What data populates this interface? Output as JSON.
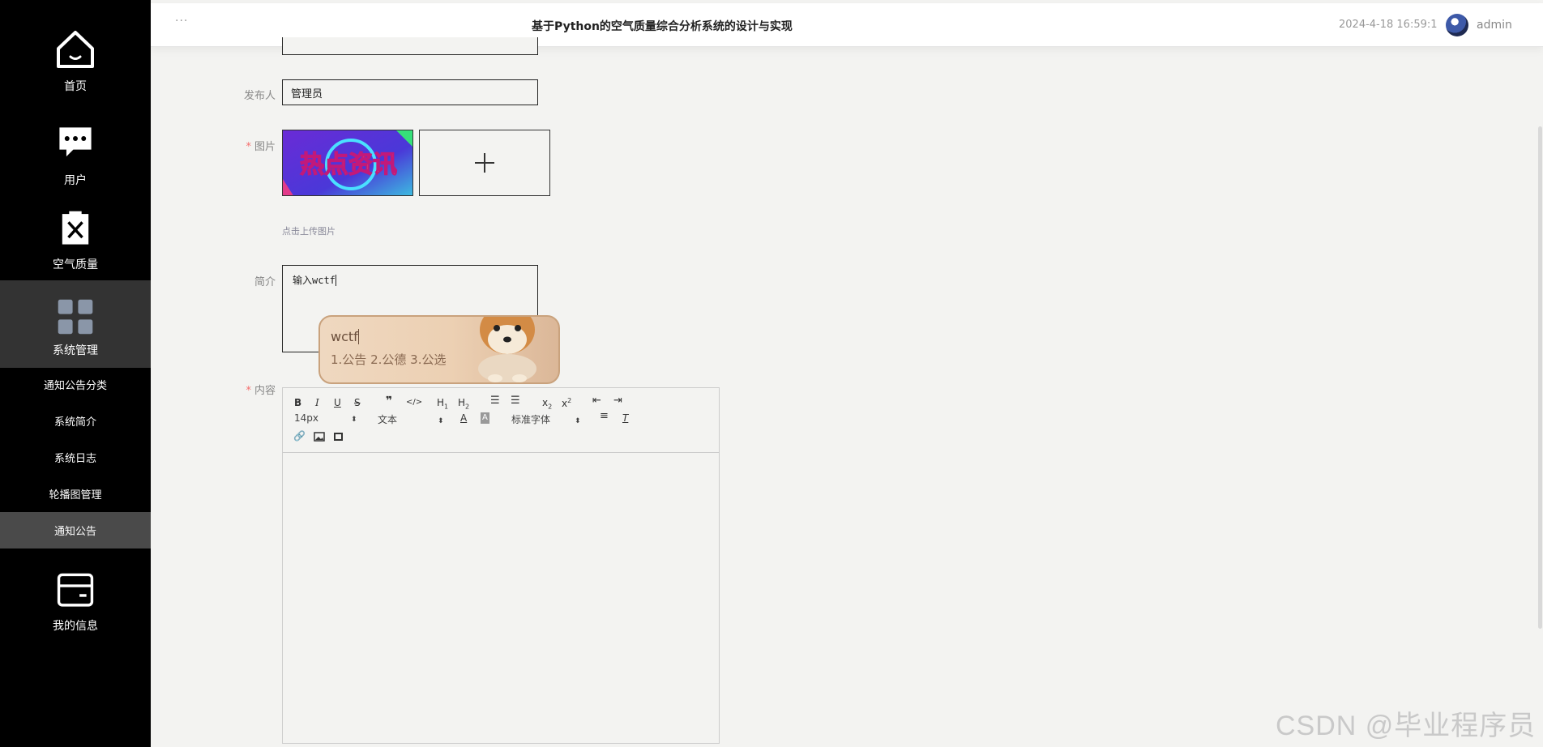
{
  "sidebar": {
    "items": [
      {
        "label": "首页",
        "icon": "home-icon"
      },
      {
        "label": "用户",
        "icon": "chat-icon"
      },
      {
        "label": "空气质量",
        "icon": "clipboard-x-icon"
      },
      {
        "label": "系统管理",
        "icon": "grid-icon"
      },
      {
        "label": "我的信息",
        "icon": "card-icon"
      }
    ],
    "sub_items": [
      "通知公告分类",
      "系统简介",
      "系统日志",
      "轮播图管理",
      "通知公告"
    ]
  },
  "header": {
    "menu": "···",
    "title": "基于Python的空气质量综合分析系统的设计与实现",
    "time": "2024-4-18 16:59:1",
    "user": "admin"
  },
  "form": {
    "publisher_label": "发布人",
    "publisher_value": "管理员",
    "required_mark": "*",
    "image_label": "图片",
    "image_text": "热点资讯",
    "upload_tip": "点击上传图片",
    "summary_label": "简介",
    "summary_value": "输入wctf",
    "content_label": "内容"
  },
  "ime": {
    "input": "wctf",
    "candidates": "1.公告  2.公德  3.公选"
  },
  "editor": {
    "font_size": "14px",
    "block_type": "文本",
    "font_family": "标准字体"
  },
  "watermark": "CSDN @毕业程序员"
}
